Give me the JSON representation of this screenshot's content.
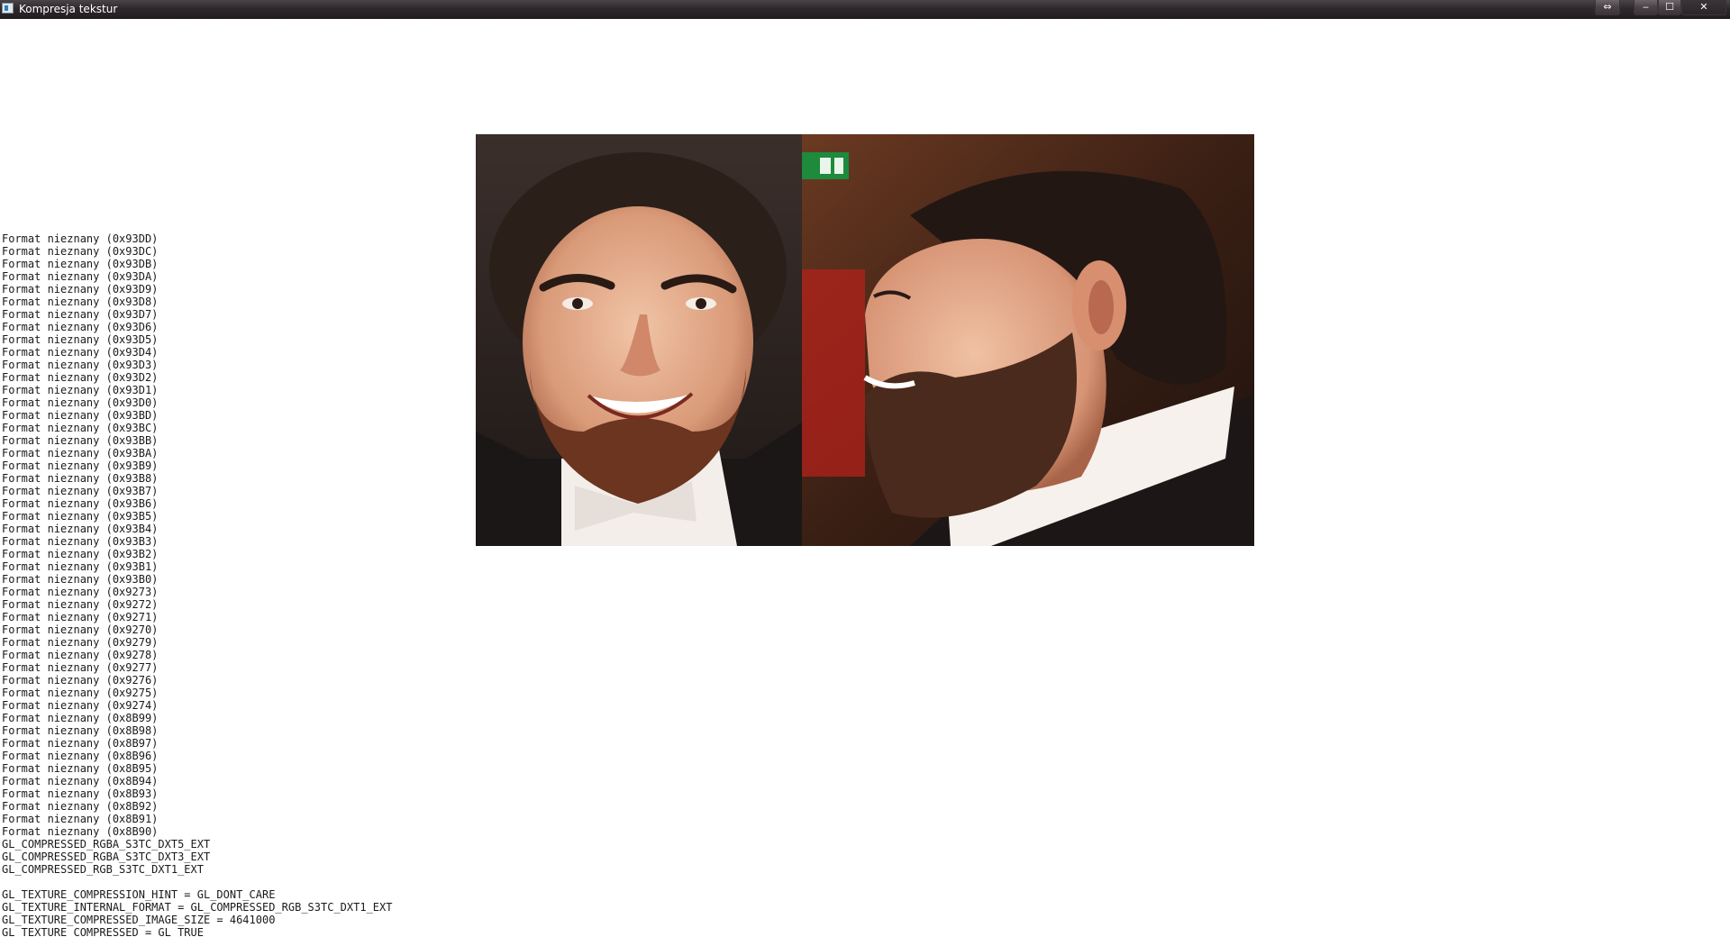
{
  "window": {
    "title": "Kompresja tekstur",
    "buttons": {
      "resize": "⇔",
      "minimize": "‒",
      "maximize": "☐",
      "close": "✕"
    }
  },
  "texture": {
    "left_photo": "face-frontal-photo",
    "right_photo": "face-profile-photo"
  },
  "console": {
    "lines": [
      "Format nieznany (0x93DD)",
      "Format nieznany (0x93DC)",
      "Format nieznany (0x93DB)",
      "Format nieznany (0x93DA)",
      "Format nieznany (0x93D9)",
      "Format nieznany (0x93D8)",
      "Format nieznany (0x93D7)",
      "Format nieznany (0x93D6)",
      "Format nieznany (0x93D5)",
      "Format nieznany (0x93D4)",
      "Format nieznany (0x93D3)",
      "Format nieznany (0x93D2)",
      "Format nieznany (0x93D1)",
      "Format nieznany (0x93D0)",
      "Format nieznany (0x93BD)",
      "Format nieznany (0x93BC)",
      "Format nieznany (0x93BB)",
      "Format nieznany (0x93BA)",
      "Format nieznany (0x93B9)",
      "Format nieznany (0x93B8)",
      "Format nieznany (0x93B7)",
      "Format nieznany (0x93B6)",
      "Format nieznany (0x93B5)",
      "Format nieznany (0x93B4)",
      "Format nieznany (0x93B3)",
      "Format nieznany (0x93B2)",
      "Format nieznany (0x93B1)",
      "Format nieznany (0x93B0)",
      "Format nieznany (0x9273)",
      "Format nieznany (0x9272)",
      "Format nieznany (0x9271)",
      "Format nieznany (0x9270)",
      "Format nieznany (0x9279)",
      "Format nieznany (0x9278)",
      "Format nieznany (0x9277)",
      "Format nieznany (0x9276)",
      "Format nieznany (0x9275)",
      "Format nieznany (0x9274)",
      "Format nieznany (0x8B99)",
      "Format nieznany (0x8B98)",
      "Format nieznany (0x8B97)",
      "Format nieznany (0x8B96)",
      "Format nieznany (0x8B95)",
      "Format nieznany (0x8B94)",
      "Format nieznany (0x8B93)",
      "Format nieznany (0x8B92)",
      "Format nieznany (0x8B91)",
      "Format nieznany (0x8B90)",
      "GL_COMPRESSED_RGBA_S3TC_DXT5_EXT",
      "GL_COMPRESSED_RGBA_S3TC_DXT3_EXT",
      "GL_COMPRESSED_RGB_S3TC_DXT1_EXT",
      "",
      "GL_TEXTURE_COMPRESSION_HINT = GL_DONT_CARE",
      "GL_TEXTURE_INTERNAL_FORMAT = GL_COMPRESSED_RGB_S3TC_DXT1_EXT",
      "GL_TEXTURE_COMPRESSED_IMAGE_SIZE = 4641000",
      "GL_TEXTURE_COMPRESSED = GL_TRUE"
    ]
  }
}
